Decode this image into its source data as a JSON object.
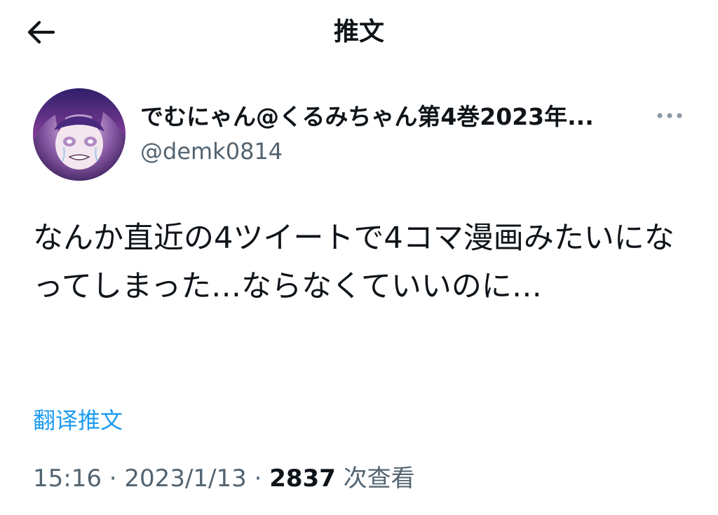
{
  "header": {
    "title": "推文"
  },
  "author": {
    "display_name": "でむにゃん@くるみちゃん第4巻2023年...",
    "handle": "@demk0814"
  },
  "tweet": {
    "text": "なんか直近の4ツイートで4コマ漫画みたいになってしまった…ならなくていいのに…",
    "translate_label": "翻译推文",
    "time": "15:16",
    "separator": "·",
    "date": "2023/1/13",
    "views_count": "2837",
    "views_label": "次查看"
  },
  "icons": {
    "back": "back-arrow-icon",
    "more": "more-horizontal-icon"
  },
  "colors": {
    "text_primary": "#0f1419",
    "text_secondary": "#536471",
    "link": "#1d9bf0"
  }
}
